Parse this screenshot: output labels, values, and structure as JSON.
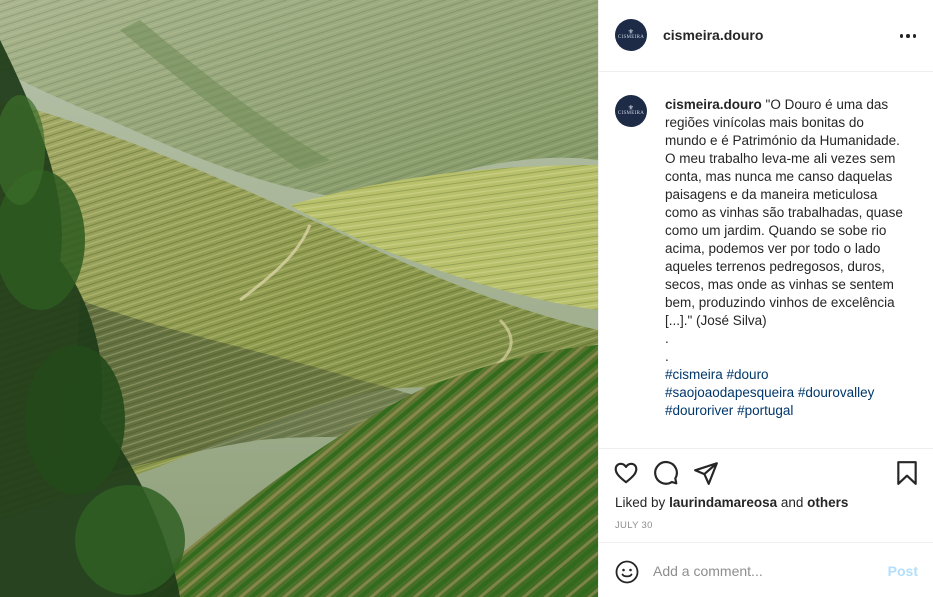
{
  "post": {
    "username": "cismeira.douro",
    "avatar_text": "CISMEIRA",
    "more_icon": "more-options-icon"
  },
  "caption": {
    "username": "cismeira.douro",
    "text": "\"O Douro é uma das regiões vinícolas mais bonitas do mundo e é Património da Humanidade. O meu trabalho leva-me ali vezes sem conta, mas nunca me canso daquelas paisagens e da maneira meticulosa como as vinhas são trabalhadas, quase como um jardim. Quando se sobe rio acima, podemos ver por todo o lado aqueles terrenos pedregosos, duros, secos, mas onde as vinhas se sentem bem, produzindo vinhos de excelência [...].\" (José Silva)",
    "dots": [
      ".",
      "."
    ],
    "hashtags": [
      [
        "#cismeira",
        "#douro"
      ],
      [
        "#saojoaodapesqueira",
        "#dourovalley"
      ],
      [
        "#douroriver",
        "#portugal"
      ]
    ]
  },
  "actions": {
    "icons": [
      "heart-icon",
      "comment-icon",
      "share-icon",
      "bookmark-icon"
    ],
    "liked_by_prefix": "Liked by",
    "liked_by_user": "laurindamareosa",
    "liked_by_and": "and",
    "liked_by_others": "others",
    "date": "JULY 30"
  },
  "comment": {
    "placeholder": "Add a comment...",
    "post_label": "Post",
    "post_color": "#b2dffc"
  },
  "colors": {
    "text": "#262626",
    "link": "#00376b",
    "muted": "#8e8e8e",
    "avatar_bg": "#1d2b46"
  }
}
